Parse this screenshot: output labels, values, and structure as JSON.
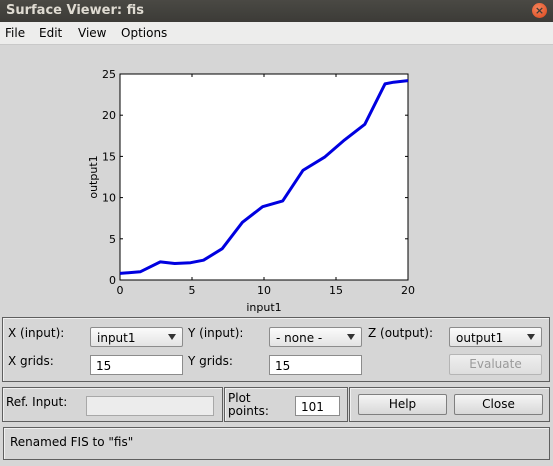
{
  "window": {
    "title": "Surface Viewer: fis",
    "close_icon": "close-icon"
  },
  "menu": [
    "File",
    "Edit",
    "View",
    "Options"
  ],
  "chart_data": {
    "type": "line",
    "xlabel": "input1",
    "ylabel": "output1",
    "xlim": [
      0,
      20
    ],
    "ylim": [
      0,
      25
    ],
    "x_ticks": [
      0,
      5,
      10,
      15,
      20
    ],
    "y_ticks": [
      0,
      5,
      10,
      15,
      20,
      25
    ],
    "x_tick_labels": [
      "0",
      "5",
      "10",
      "15",
      "20"
    ],
    "y_tick_labels": [
      "0",
      "5",
      "10",
      "15",
      "20",
      "25"
    ],
    "color": "#0000e0",
    "grid": false,
    "x": [
      0,
      1.4,
      2.8,
      3.8,
      4.9,
      5.8,
      7.1,
      8.5,
      9.9,
      11.3,
      12.7,
      14.2,
      15.6,
      17.0,
      18.4,
      19.0,
      20.0
    ],
    "y": [
      0.8,
      1.0,
      2.2,
      2.0,
      2.1,
      2.4,
      3.8,
      7.0,
      8.9,
      9.6,
      13.3,
      14.9,
      17.0,
      18.9,
      23.8,
      24.0,
      24.2
    ]
  },
  "controls": {
    "x_input_label": "X (input):",
    "x_input_value": "input1",
    "y_input_label": "Y (input):",
    "y_input_value": "- none -",
    "z_output_label": "Z (output):",
    "z_output_value": "output1",
    "x_grids_label": "X grids:",
    "x_grids_value": "15",
    "y_grids_label": "Y grids:",
    "y_grids_value": "15",
    "evaluate_label": "Evaluate"
  },
  "bottom": {
    "ref_input_label": "Ref. Input:",
    "ref_input_value": "",
    "plot_points_label": "Plot points:",
    "plot_points_value": "101",
    "help_label": "Help",
    "close_label": "Close"
  },
  "status": "Renamed FIS to \"fis\""
}
